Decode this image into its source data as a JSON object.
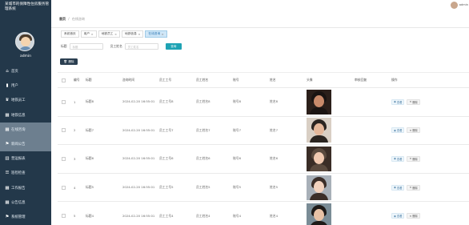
{
  "sidebar": {
    "title": "某城市的保障性住房服务管理系统",
    "user": "admin",
    "items": [
      {
        "label": "首页",
        "icon": "home-icon",
        "glyph": "⌂",
        "active": false
      },
      {
        "label": "用户",
        "icon": "user-icon",
        "glyph": "▮",
        "active": false
      },
      {
        "label": "地铁员工",
        "icon": "employee-icon",
        "glyph": "♛",
        "active": false
      },
      {
        "label": "地铁信息",
        "icon": "grid-icon",
        "glyph": "▦",
        "active": false
      },
      {
        "label": "在线咨询",
        "icon": "grid-icon",
        "glyph": "▦",
        "active": true
      },
      {
        "label": "新闻公告",
        "icon": "flag-icon",
        "glyph": "⚑",
        "active": true
      },
      {
        "label": "营运报表",
        "icon": "chart-icon",
        "glyph": "▥",
        "active": false
      },
      {
        "label": "巡检检查",
        "icon": "list-icon",
        "glyph": "☰",
        "active": false
      },
      {
        "label": "工作报告",
        "icon": "grid-icon",
        "glyph": "▦",
        "active": false
      },
      {
        "label": "公告信息",
        "icon": "grid-icon",
        "glyph": "▦",
        "active": false
      },
      {
        "label": "系统管理",
        "icon": "flag-icon",
        "glyph": "⚑",
        "active": false
      }
    ]
  },
  "topbar": {
    "user": "admin"
  },
  "breadcrumb": {
    "home": "首页",
    "sep": "/",
    "current": "在线咨询"
  },
  "tabs": [
    {
      "label": "系统首页",
      "closable": false,
      "active": false
    },
    {
      "label": "用户",
      "closable": true,
      "active": false
    },
    {
      "label": "地铁员工",
      "closable": true,
      "active": false
    },
    {
      "label": "地铁信息",
      "closable": true,
      "active": false
    },
    {
      "label": "在线咨询",
      "closable": true,
      "active": true
    }
  ],
  "search": {
    "title_label": "标题",
    "title_placeholder": "标题",
    "wid_label": "员工姓名",
    "wid_placeholder": "员工姓名",
    "button": "查询"
  },
  "delete_button": "删除",
  "table": {
    "headers": [
      "",
      "编号",
      "标题",
      "咨询时间",
      "员工工号",
      "员工姓名",
      "账号",
      "姓名",
      "头像",
      "审核回复",
      "操作"
    ],
    "rows": [
      {
        "no": "1",
        "title": "标题8",
        "time": "2024-02-20 16:55:01",
        "wid": "员工工号8",
        "wname": "员工姓名8",
        "account": "账号8",
        "name": "姓名8",
        "reply": ""
      },
      {
        "no": "2",
        "title": "标题7",
        "time": "2024-02-20 16:55:01",
        "wid": "员工工号7",
        "wname": "员工姓名7",
        "account": "账号7",
        "name": "姓名7",
        "reply": ""
      },
      {
        "no": "3",
        "title": "标题6",
        "time": "2024-02-20 16:55:01",
        "wid": "员工工号6",
        "wname": "员工姓名6",
        "account": "账号6",
        "name": "姓名6",
        "reply": ""
      },
      {
        "no": "4",
        "title": "标题5",
        "time": "2024-02-20 16:55:01",
        "wid": "员工工号5",
        "wname": "员工姓名5",
        "account": "账号5",
        "name": "姓名5",
        "reply": ""
      },
      {
        "no": "5",
        "title": "标题4",
        "time": "2024-02-20 16:55:01",
        "wid": "员工工号4",
        "wname": "员工姓名4",
        "account": "账号4",
        "name": "姓名4",
        "reply": ""
      }
    ],
    "view_label": "查看",
    "delete_label": "删除"
  }
}
